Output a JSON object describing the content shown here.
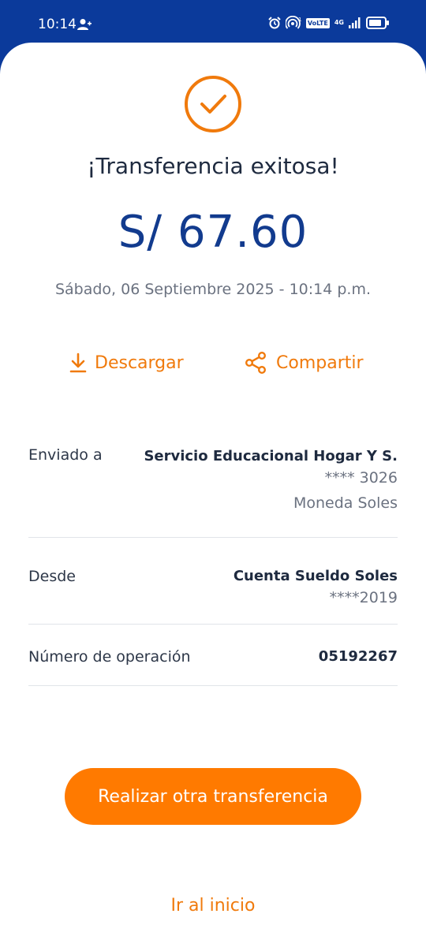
{
  "status_bar": {
    "time": "10:14",
    "volte": "VoLTE",
    "network": "4G",
    "icons": [
      "user-add-icon",
      "alarm-icon",
      "hotspot-icon",
      "signal-icon",
      "battery-icon"
    ]
  },
  "receipt": {
    "title": "¡Transferencia exitosa!",
    "amount": "S/ 67.60",
    "datetime": "Sábado, 06 Septiembre 2025 - 10:14 p.m."
  },
  "actions": {
    "download_label": "Descargar",
    "share_label": "Compartir"
  },
  "details": {
    "sent_to": {
      "label": "Enviado a",
      "name": "Servicio Educacional Hogar Y S.",
      "account": "**** 3026",
      "currency": "Moneda Soles"
    },
    "from": {
      "label": "Desde",
      "account_name": "Cuenta Sueldo Soles",
      "account": "****2019"
    },
    "operation": {
      "label": "Número de operación",
      "number": "05192267"
    }
  },
  "buttons": {
    "new_transfer": "Realizar otra transferencia",
    "go_home": "Ir al inicio"
  },
  "colors": {
    "header": "#0b3a9b",
    "accent": "#ff7a00",
    "amount": "#123b8e"
  }
}
